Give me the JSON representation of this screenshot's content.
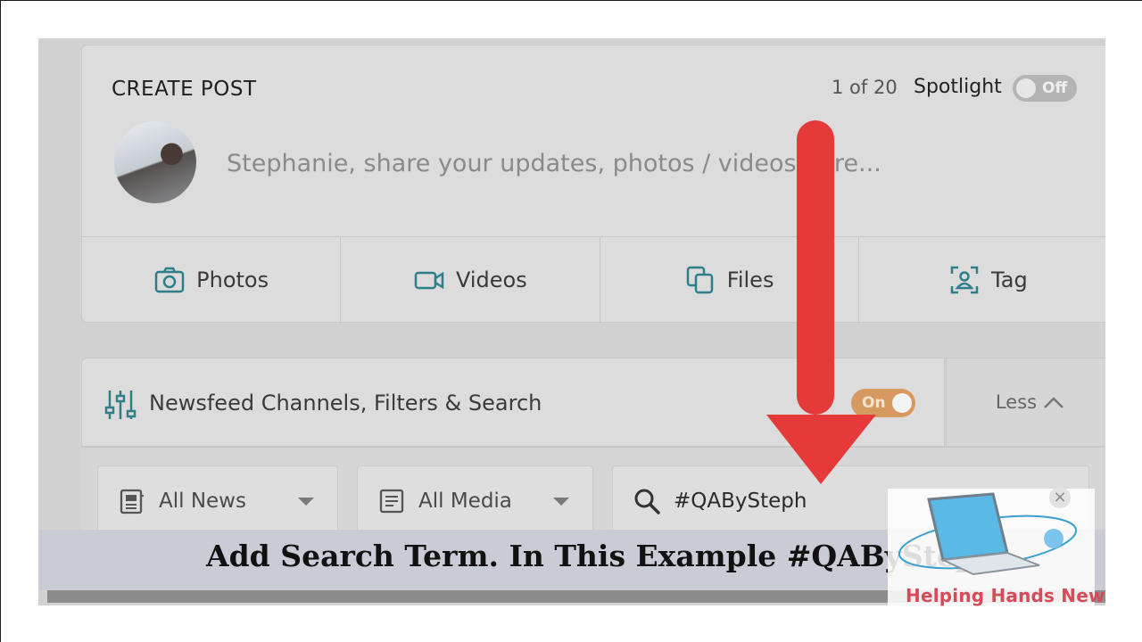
{
  "create_post": {
    "title": "CREATE POST",
    "post_count": "1 of 20",
    "spotlight_label": "Spotlight",
    "spotlight_state": "Off",
    "composer_placeholder": "Stephanie, share your updates, photos / videos here...",
    "actions": [
      {
        "label": "Photos",
        "icon": "camera-icon"
      },
      {
        "label": "Videos",
        "icon": "video-camera-icon"
      },
      {
        "label": "Files",
        "icon": "files-icon"
      },
      {
        "label": "Tag",
        "icon": "tag-user-icon"
      }
    ]
  },
  "newsfeed": {
    "title": "Newsfeed Channels, Filters & Search",
    "toggle_state": "On",
    "less_label": "Less",
    "filters": {
      "news": "All News",
      "media": "All Media",
      "search_value": "#QABySteph"
    }
  },
  "caption": "Add Search Term. In This Example #QABySteph",
  "logo": {
    "text": "Helping Hands New"
  },
  "colors": {
    "accent_teal": "#2e7f8a",
    "arrow_red": "#e63a3a",
    "toggle_on": "#d69a60",
    "logo_text": "#d64a5a"
  }
}
